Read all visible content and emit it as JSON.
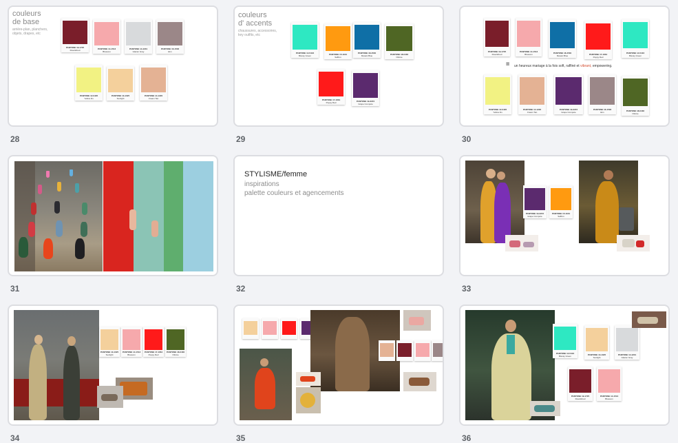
{
  "slides": [
    {
      "number": "28",
      "title_line1": "couleurs",
      "title_line2": "de base",
      "subtitle_line1": "arrière-plan, planchers,",
      "subtitle_line2": "objets, drapes, etc"
    },
    {
      "number": "29",
      "title_line1": "couleurs",
      "title_line2": "d' accents",
      "subtitle_line1": "chaussures, accessoires,",
      "subtitle_line2": "key outfits, etc"
    },
    {
      "number": "30",
      "tagline_pre": "un heureux mariage à la fois soft, raffiné et",
      "tagline_hl": "vibrant,",
      "tagline_post": "empowering."
    },
    {
      "number": "31"
    },
    {
      "number": "32",
      "title": "STYLISME/femme",
      "line1": "inspirations",
      "line2": "palette couleurs et agencements"
    },
    {
      "number": "33"
    },
    {
      "number": "34"
    },
    {
      "number": "35"
    },
    {
      "number": "36"
    }
  ],
  "swatches": {
    "redwood": {
      "code": "PANTONE 19-1725",
      "name": "RoseWood",
      "color": "#7a1e2a"
    },
    "blossom": {
      "code": "PANTONE 14-1513",
      "name": "Blossom",
      "color": "#f6a9ac"
    },
    "glacier": {
      "code": "PANTONE 14-4201",
      "name": "Glacier Gray",
      "color": "#d8dadc"
    },
    "mauve": {
      "code": "PANTONE 16-1506",
      "name": "Elm",
      "color": "#9b8788"
    },
    "yellow": {
      "code": "PANTONE 12-0435",
      "name": "Yellow Iris",
      "color": "#f2f283"
    },
    "sand": {
      "code": "PANTONE 13-1025",
      "name": "Sunlight",
      "color": "#f4d09c"
    },
    "peach": {
      "code": "PANTONE 14-1220",
      "name": "Cream Tan",
      "color": "#e4b294"
    },
    "aqua": {
      "code": "PANTONE 14-5416",
      "name": "Biscay Green",
      "color": "#2ee8c2"
    },
    "orange": {
      "code": "PANTONE 15-1164",
      "name": "Saffron",
      "color": "#ff9a10"
    },
    "blue": {
      "code": "PANTONE 18-4530",
      "name": "Mosaic Blue",
      "color": "#0f6fa6"
    },
    "olive": {
      "code": "PANTONE 18-0430",
      "name": "Olivine",
      "color": "#4f6624"
    },
    "red": {
      "code": "PANTONE 17-1664",
      "name": "Poppy Red",
      "color": "#ff1a1a"
    },
    "purple": {
      "code": "PANTONE 19-3215",
      "name": "Grape Compote",
      "color": "#5b2a6e"
    }
  },
  "colors": {
    "accent_text": "#d24a2d",
    "background": "#f2f3f6"
  }
}
